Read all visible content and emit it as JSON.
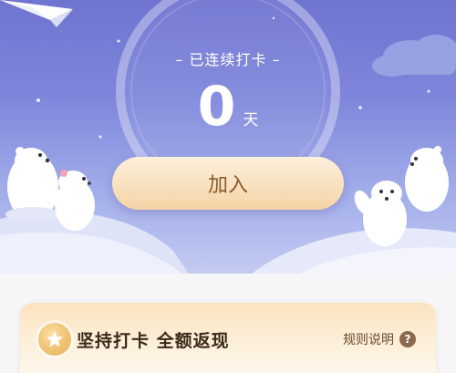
{
  "streak": {
    "label": "– 已连续打卡 –",
    "days": "0",
    "unit": "天"
  },
  "join_button": {
    "label": "加入"
  },
  "promo": {
    "title": "坚持打卡 全额返现",
    "rules_label": "规则说明",
    "help_symbol": "?"
  },
  "icons": {
    "star_badge": "star-icon",
    "help": "question-icon",
    "paper_plane": "paper-plane-icon"
  },
  "colors": {
    "sky_top": "#6f74d0",
    "button_gradient_top": "#fdf0dc",
    "button_gradient_bottom": "#f4d4a6",
    "button_text": "#8a5a2b",
    "card_bg": "#fbe3bf",
    "title_text": "#3a2a1a"
  }
}
